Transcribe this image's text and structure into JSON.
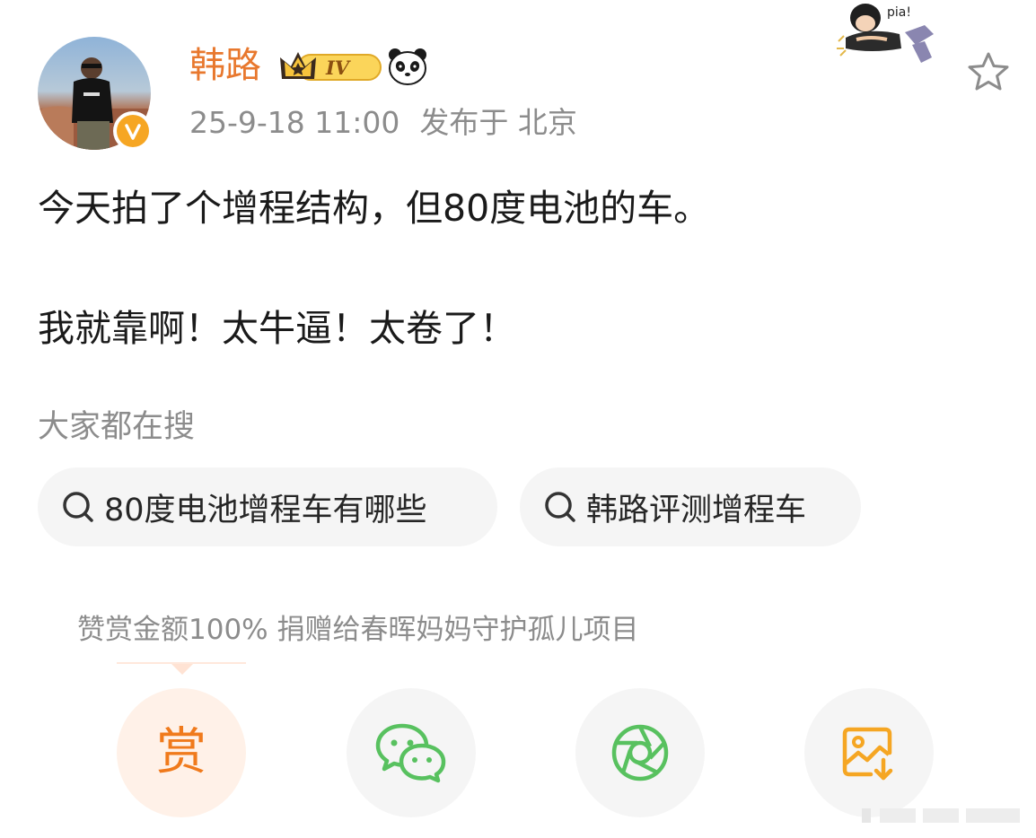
{
  "header": {
    "username": "韩路",
    "level_badge": "IV",
    "timestamp": "25-9-18 11:00",
    "location": "发布于 北京",
    "verified_icon": "v-verified-icon",
    "favorite_icon": "star-outline-icon"
  },
  "post": {
    "line1": "今天拍了个增程结构，但80度电池的车。",
    "line2": "我就靠啊！太牛逼！太卷了！"
  },
  "hot_search": {
    "title": "大家都在搜",
    "items": [
      "80度电池增程车有哪些",
      "韩路评测增程车"
    ]
  },
  "donation": {
    "notice": "赞赏金额100% 捐赠给春晖妈妈守护孤儿项目",
    "reward_label": "赏"
  },
  "share_actions": {
    "icons": [
      "reward-icon",
      "wechat-icon",
      "moments-icon",
      "save-image-icon"
    ]
  },
  "colors": {
    "accent_orange": "#e8782e",
    "wechat_green": "#58c15f",
    "save_orange": "#f5a623",
    "text_gray": "#8c8c8c"
  }
}
